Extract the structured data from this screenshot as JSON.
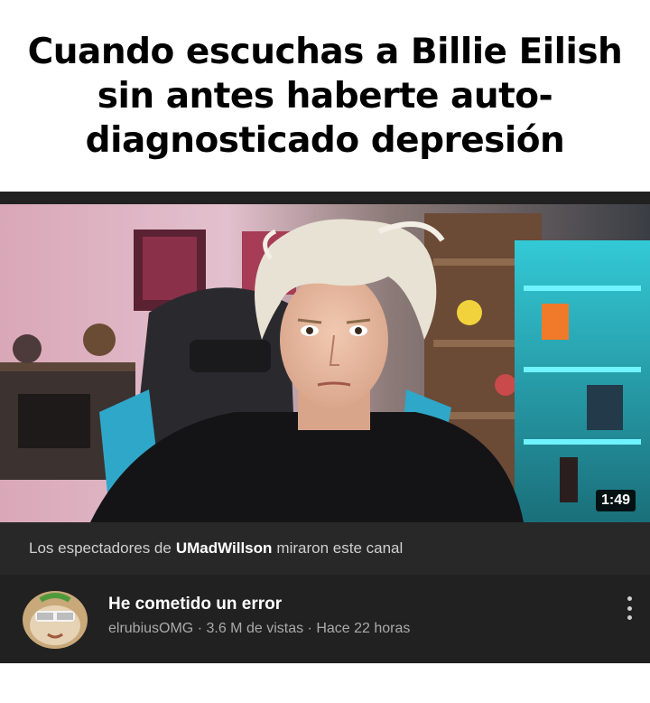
{
  "meme": {
    "caption": "Cuando escuchas a Billie Eilish sin antes haberte auto-diagnosticado depresión"
  },
  "thumbnail": {
    "duration": "1:49"
  },
  "recommendation": {
    "prefix": "Los espectadores de",
    "channel": "UMadWillson",
    "suffix": "miraron este canal"
  },
  "video": {
    "title": "He cometido un error",
    "channel": "elrubiusOMG",
    "views": "3.6 M de vistas",
    "age": "Hace 22 horas",
    "separator": "·"
  },
  "colors": {
    "background": "#212121",
    "reco_bar": "#282828",
    "title_text": "#ffffff",
    "meta_text": "#aaaaaa"
  },
  "icons": {
    "more_options": "vertical-ellipsis-icon"
  }
}
